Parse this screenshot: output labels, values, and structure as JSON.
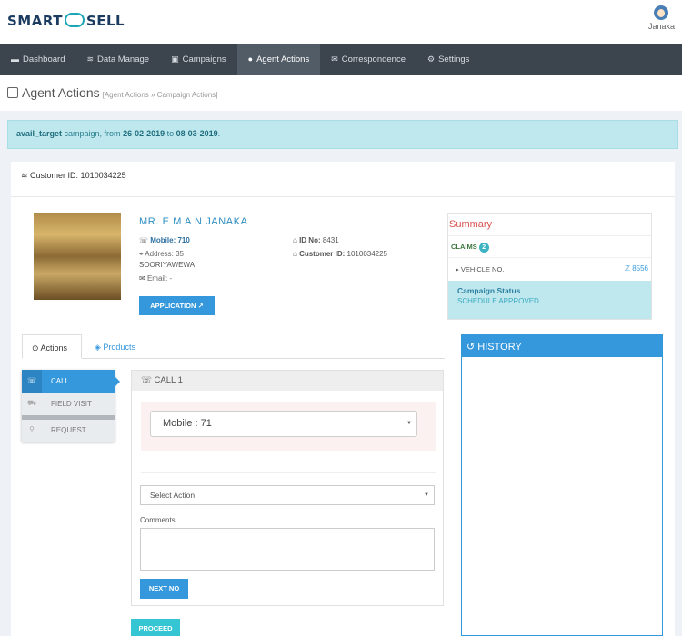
{
  "header": {
    "logo_left": "SMART",
    "logo_right": "SELL",
    "user_name": "Janaka"
  },
  "nav": {
    "items": [
      {
        "icon": "dashboard-icon",
        "glyph": "▬",
        "label": "Dashboard"
      },
      {
        "icon": "database-icon",
        "glyph": "≋",
        "label": "Data Manage"
      },
      {
        "icon": "briefcase-icon",
        "glyph": "▣",
        "label": "Campaigns"
      },
      {
        "icon": "user-icon",
        "glyph": "●",
        "label": "Agent Actions"
      },
      {
        "icon": "envelope-icon",
        "glyph": "✉",
        "label": "Correspondence"
      },
      {
        "icon": "gear-icon",
        "glyph": "⚙",
        "label": "Settings"
      }
    ],
    "active_index": 3
  },
  "page": {
    "title": "Agent Actions",
    "breadcrumb": "[Agent Actions » Campaign Actions]"
  },
  "alert": {
    "campaign": "avail_target",
    "text_mid": " campaign, from ",
    "from": "26-02-2019",
    "to_word": " to ",
    "to": "08-03-2019",
    "end": "."
  },
  "customer": {
    "id_label": "Customer ID: 1010034225",
    "name": "MR. E M A N JANAKA",
    "mobile_label": "Mobile: ",
    "mobile_value": "710",
    "address_label": "Address: 35",
    "address_line2": "SOORIYAWEWA",
    "email_label": "Email: -",
    "idno_label": "ID No: ",
    "idno_value": "8431",
    "custid_label": "Customer ID: ",
    "custid_value": "1010034225",
    "application_btn": "APPLICATION"
  },
  "summary": {
    "title": "Summary",
    "claims_label": "CLAIMS",
    "claims_count": "2",
    "vehicle_label": "VEHICLE NO.",
    "vehicle_value": "ℤ 8556",
    "status_title": "Campaign Status",
    "status_value": "SCHEDULE APPROVED"
  },
  "tabs": {
    "actions": "Actions",
    "products": "Products"
  },
  "side_menu": {
    "call": "CALL",
    "field_visit": "FIELD VISIT",
    "request": "REQUEST"
  },
  "call": {
    "heading": "CALL 1",
    "mobile_select": "Mobile : 71",
    "action_select": "Select Action",
    "comments_label": "Comments",
    "next_btn": "NEXT NO",
    "proceed_btn": "PROCEED"
  },
  "history": {
    "title": "HISTORY"
  }
}
